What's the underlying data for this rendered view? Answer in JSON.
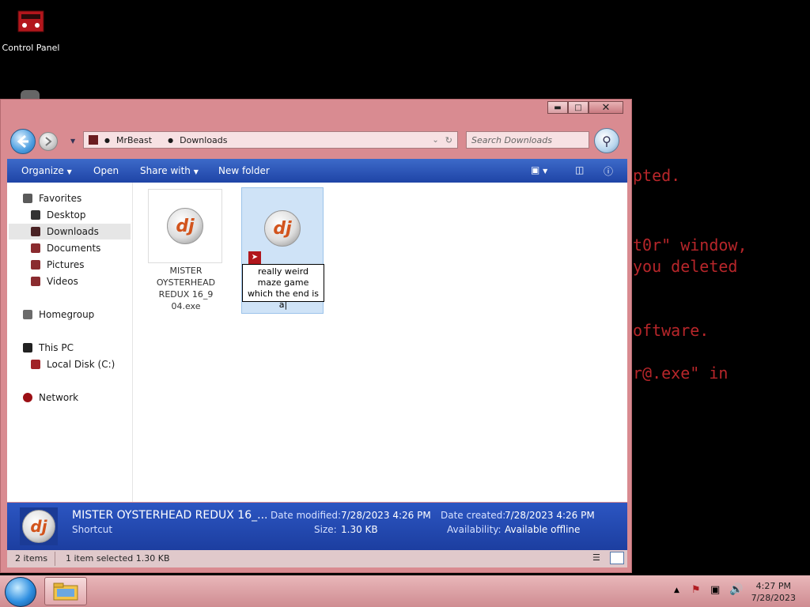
{
  "desktop": {
    "control_panel_label": "Control Panel"
  },
  "background_text": [
    {
      "text": "pted."
    },
    {
      "text": "t0r\" window,"
    },
    {
      "text": "you deleted"
    },
    {
      "text": "oftware."
    },
    {
      "text": "r@.exe\" in"
    }
  ],
  "window": {
    "address": {
      "crumbs": [
        "MrBeast",
        "Downloads"
      ]
    },
    "search_placeholder": "Search Downloads",
    "toolbar": {
      "organize": "Organize",
      "open": "Open",
      "share_with": "Share with",
      "new_folder": "New folder"
    },
    "nav": {
      "favorites": "Favorites",
      "desktop": "Desktop",
      "downloads": "Downloads",
      "documents": "Documents",
      "pictures": "Pictures",
      "videos": "Videos",
      "homegroup": "Homegroup",
      "this_pc": "This PC",
      "local_disk": "Local Disk (C:)",
      "network": "Network"
    },
    "files": [
      {
        "name": "MISTER OYSTERHEAD REDUX 16_904.exe",
        "display": "MISTER\nOYSTERHEAD\nREDUX 16_9\n04.exe"
      },
      {
        "rename_value": "really weird maze game which the end is a"
      }
    ],
    "details": {
      "name": "MISTER OYSTERHEAD REDUX 16_...",
      "type": "Shortcut",
      "date_modified_label": "Date modified:",
      "date_modified": "7/28/2023 4:26 PM",
      "size_label": "Size:",
      "size": "1.30 KB",
      "date_created_label": "Date created:",
      "date_created": "7/28/2023 4:26 PM",
      "availability_label": "Availability:",
      "availability": "Available offline"
    },
    "status": {
      "items": "2 items",
      "selected": "1 item selected  1.30 KB"
    }
  },
  "taskbar": {
    "time": "4:27 PM",
    "date": "7/28/2023"
  },
  "logo_text": "dj"
}
